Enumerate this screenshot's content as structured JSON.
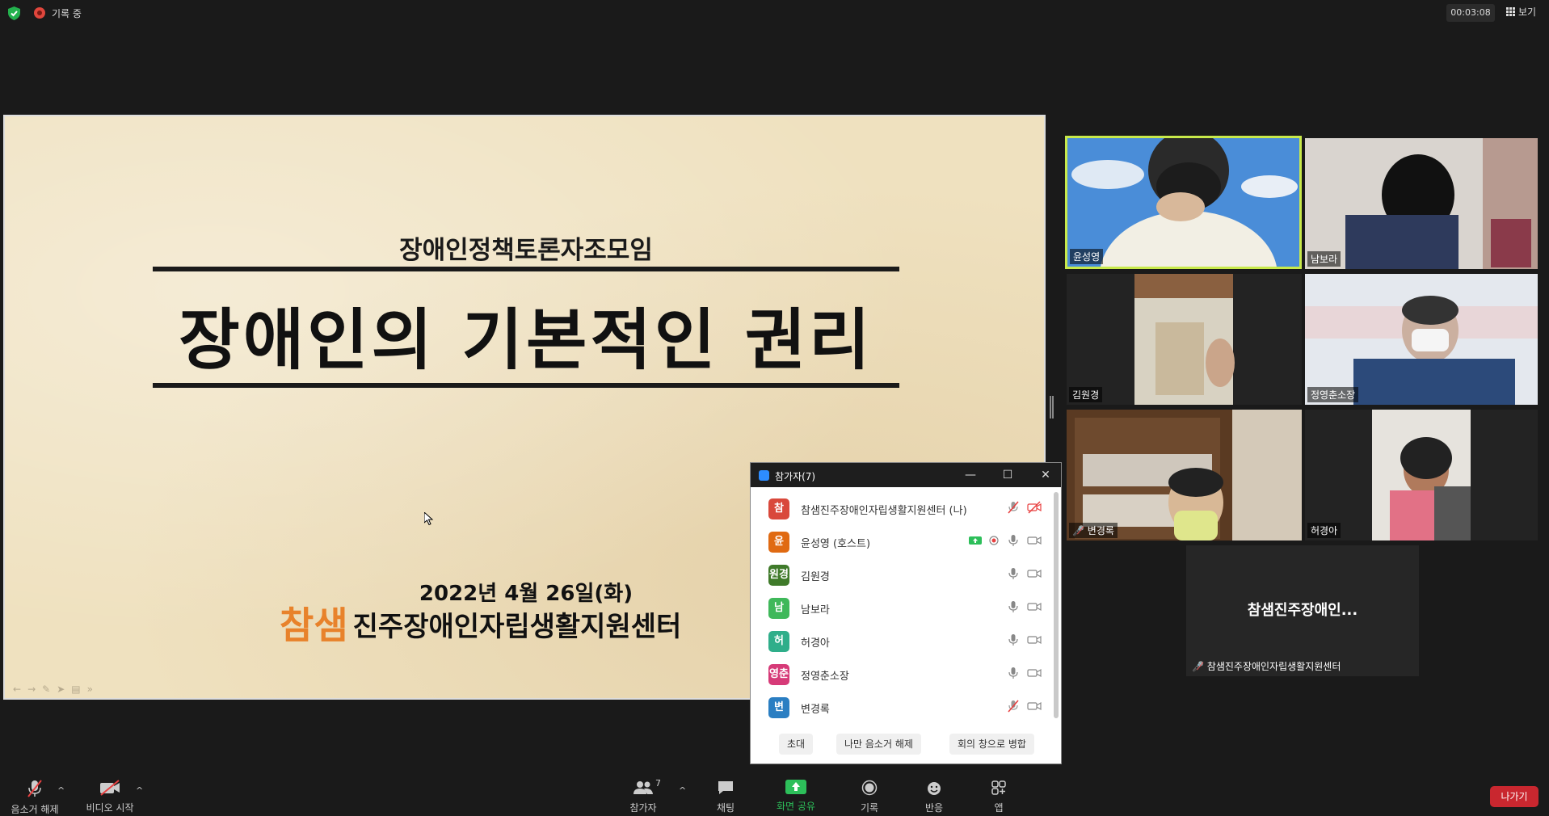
{
  "top_bar": {
    "recording_label": "기록 중",
    "timer": "00:03:08",
    "view_label": "보기"
  },
  "slide": {
    "subtitle": "장애인정책토론자조모임",
    "title": "장애인의 기본적인 권리",
    "date": "2022년 4월 26일(화)",
    "org_logo": "참샘",
    "org_name": "진주장애인자립생활지원센터"
  },
  "gallery": {
    "tiles": [
      {
        "name": "윤성영"
      },
      {
        "name": "남보라"
      },
      {
        "name": "김원경"
      },
      {
        "name": "정영춘소장"
      },
      {
        "name": "변경록"
      },
      {
        "name": "허경아"
      },
      {
        "name": "참샘진주장애인자립생활지원센터",
        "display": "참샘진주장애인..."
      }
    ],
    "active_speaker_color": "#c8e94a"
  },
  "participants_panel": {
    "title": "참가자(7)",
    "participants": [
      {
        "avatar": "참",
        "avatar_color": "#d9483b",
        "name": "참샘진주장애인자립생활지원센터 (나)",
        "mic": "muted",
        "video": "off"
      },
      {
        "avatar": "윤",
        "avatar_color": "#e06a12",
        "name": "윤성영 (호스트)",
        "mic": "on",
        "video": "on",
        "sharing": true,
        "recording": true
      },
      {
        "avatar": "원경",
        "avatar_color": "#3f7a2a",
        "name": "김원경",
        "mic": "on",
        "video": "on"
      },
      {
        "avatar": "남",
        "avatar_color": "#3fb85a",
        "name": "남보라",
        "mic": "on",
        "video": "on"
      },
      {
        "avatar": "허",
        "avatar_color": "#2fae8a",
        "name": "허경아",
        "mic": "on",
        "video": "on"
      },
      {
        "avatar": "영춘",
        "avatar_color": "#d63a78",
        "name": "정영춘소장",
        "mic": "on",
        "video": "on"
      },
      {
        "avatar": "변",
        "avatar_color": "#2a7ec2",
        "name": "변경록",
        "mic": "muted",
        "video": "on"
      }
    ],
    "buttons": {
      "invite": "초대",
      "unmute_me": "나만 음소거 해제",
      "merge": "회의 창으로 병합"
    }
  },
  "toolbar": {
    "unmute": "음소거 해제",
    "start_video": "비디오 시작",
    "participants": "참가자",
    "participants_count": "7",
    "chat": "채팅",
    "share_screen": "화면 공유",
    "record": "기록",
    "reactions": "반응",
    "apps": "앱",
    "leave": "나가기"
  }
}
